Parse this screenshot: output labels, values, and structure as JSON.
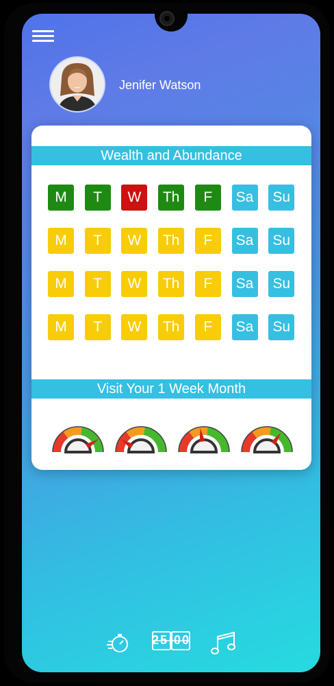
{
  "user": {
    "name": "Jenifer Watson"
  },
  "wealth_card": {
    "title": "Wealth and Abundance",
    "rows": [
      [
        {
          "label": "M",
          "status": "done"
        },
        {
          "label": "T",
          "status": "done"
        },
        {
          "label": "W",
          "status": "missed"
        },
        {
          "label": "Th",
          "status": "done"
        },
        {
          "label": "F",
          "status": "done"
        },
        {
          "label": "Sa",
          "status": "weekend"
        },
        {
          "label": "Su",
          "status": "weekend"
        }
      ],
      [
        {
          "label": "M",
          "status": "pending"
        },
        {
          "label": "T",
          "status": "pending"
        },
        {
          "label": "W",
          "status": "pending"
        },
        {
          "label": "Th",
          "status": "pending"
        },
        {
          "label": "F",
          "status": "pending"
        },
        {
          "label": "Sa",
          "status": "weekend"
        },
        {
          "label": "Su",
          "status": "weekend"
        }
      ],
      [
        {
          "label": "M",
          "status": "pending"
        },
        {
          "label": "T",
          "status": "pending"
        },
        {
          "label": "W",
          "status": "pending"
        },
        {
          "label": "Th",
          "status": "pending"
        },
        {
          "label": "F",
          "status": "pending"
        },
        {
          "label": "Sa",
          "status": "weekend"
        },
        {
          "label": "Su",
          "status": "weekend"
        }
      ],
      [
        {
          "label": "M",
          "status": "pending"
        },
        {
          "label": "T",
          "status": "pending"
        },
        {
          "label": "W",
          "status": "pending"
        },
        {
          "label": "Th",
          "status": "pending"
        },
        {
          "label": "F",
          "status": "pending"
        },
        {
          "label": "Sa",
          "status": "weekend"
        },
        {
          "label": "Su",
          "status": "weekend"
        }
      ]
    ],
    "status_colors": {
      "done": "#1f8a13",
      "missed": "#cc1111",
      "pending": "#f8cc08",
      "weekend": "#36bfe0"
    }
  },
  "week_section": {
    "title": "Visit Your 1 Week Month",
    "gauges": [
      {
        "level": 0.82
      },
      {
        "level": 0.18
      },
      {
        "level": 0.45
      },
      {
        "level": 0.7
      }
    ],
    "gauge_colors": {
      "low": "#e63a2a",
      "mid": "#f49a22",
      "high": "#46b82e"
    }
  },
  "bottom_bar": {
    "timer_display": "25:00",
    "icons": [
      "stopwatch-icon",
      "timer-display-icon",
      "music-note-icon"
    ]
  }
}
